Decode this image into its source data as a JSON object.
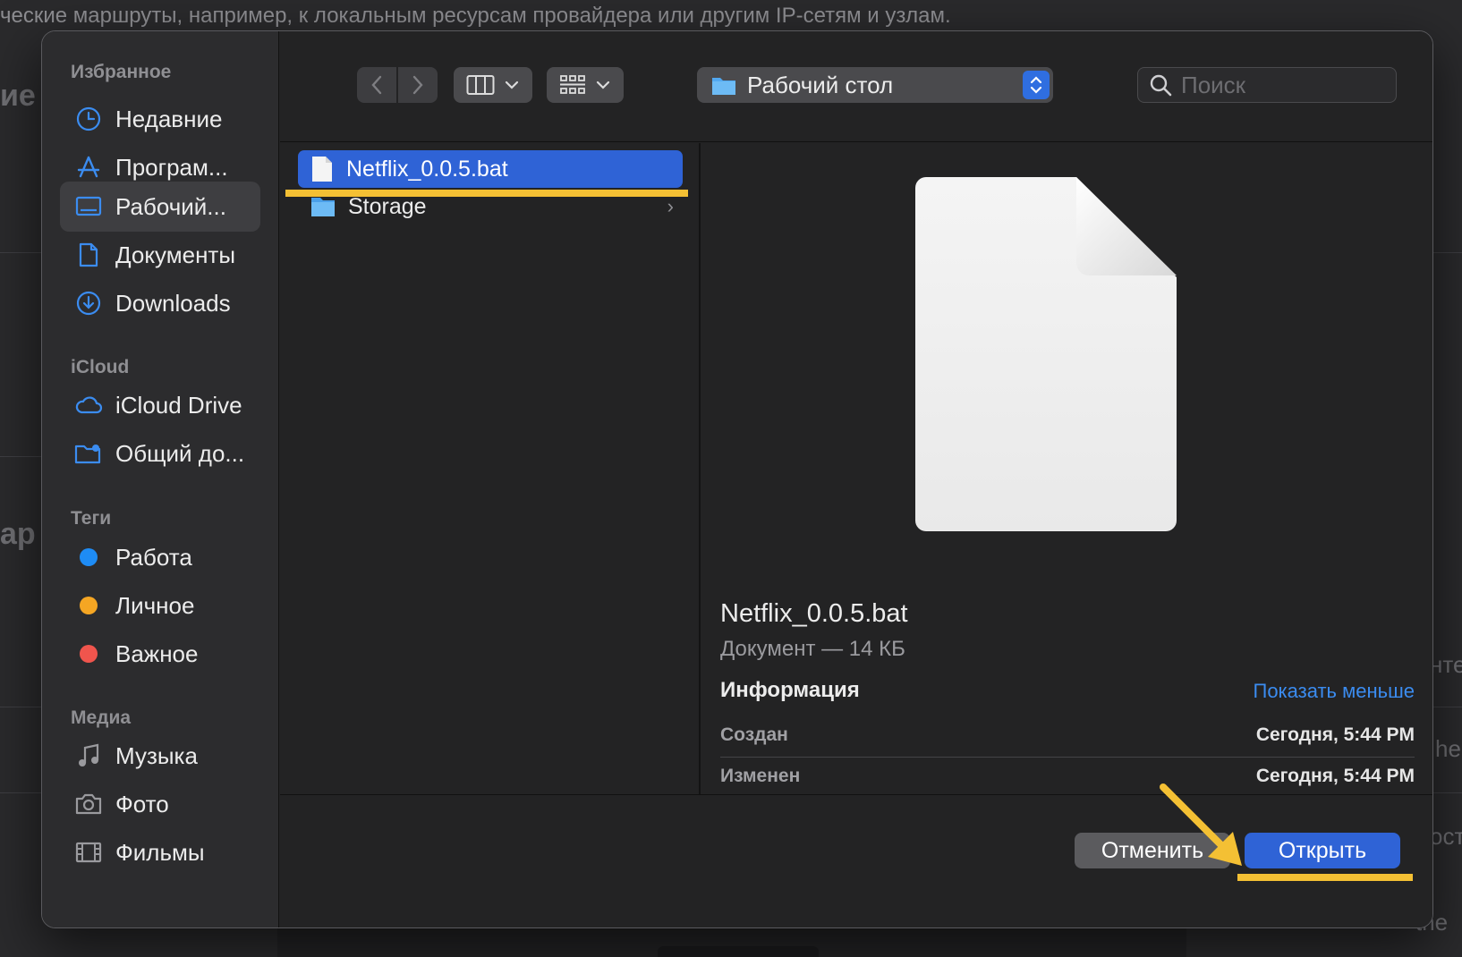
{
  "background": {
    "top_text": "ческие маршруты, например, к локальным ресурсам провайдера или другим IP-сетям и узлам.",
    "frag_left_1": "ие",
    "frag_left_2": "ар",
    "frag_right_1": "нте",
    "frag_right_2": "he",
    "frag_right_3": "ост",
    "frag_right_4": "the"
  },
  "sidebar": {
    "favorites_header": "Избранное",
    "favorites": [
      {
        "label": "Недавние",
        "icon": "clock-icon"
      },
      {
        "label": "Програм...",
        "icon": "applications-icon"
      },
      {
        "label": "Рабочий...",
        "icon": "desktop-icon",
        "selected": true
      },
      {
        "label": "Документы",
        "icon": "document-icon"
      },
      {
        "label": "Downloads",
        "icon": "download-icon"
      }
    ],
    "icloud_header": "iCloud",
    "icloud": [
      {
        "label": "iCloud Drive",
        "icon": "cloud-icon"
      },
      {
        "label": "Общий до...",
        "icon": "shared-folder-icon"
      }
    ],
    "tags_header": "Теги",
    "tags": [
      {
        "label": "Работа",
        "color": "#1e8cf5"
      },
      {
        "label": "Личное",
        "color": "#f5a623"
      },
      {
        "label": "Важное",
        "color": "#f0554d"
      }
    ],
    "media_header": "Медиа",
    "media": [
      {
        "label": "Музыка",
        "icon": "music-icon"
      },
      {
        "label": "Фото",
        "icon": "camera-icon"
      },
      {
        "label": "Фильмы",
        "icon": "film-icon"
      }
    ]
  },
  "toolbar": {
    "location": "Рабочий стол",
    "search_placeholder": "Поиск"
  },
  "files": [
    {
      "name": "Netflix_0.0.5.bat",
      "type": "document",
      "selected": true
    },
    {
      "name": "Storage",
      "type": "folder",
      "selected": false
    }
  ],
  "preview": {
    "name": "Netflix_0.0.5.bat",
    "kind": "Документ — 14 КБ",
    "info_title": "Информация",
    "show_less": "Показать меньше",
    "created_label": "Создан",
    "created_value": "Сегодня, 5:44 PM",
    "modified_label": "Изменен",
    "modified_value": "Сегодня, 5:44 PM"
  },
  "buttons": {
    "cancel": "Отменить",
    "open": "Открыть"
  },
  "colors": {
    "accent": "#2f63d6",
    "highlight": "#f4c034",
    "link": "#3b8cf0"
  }
}
